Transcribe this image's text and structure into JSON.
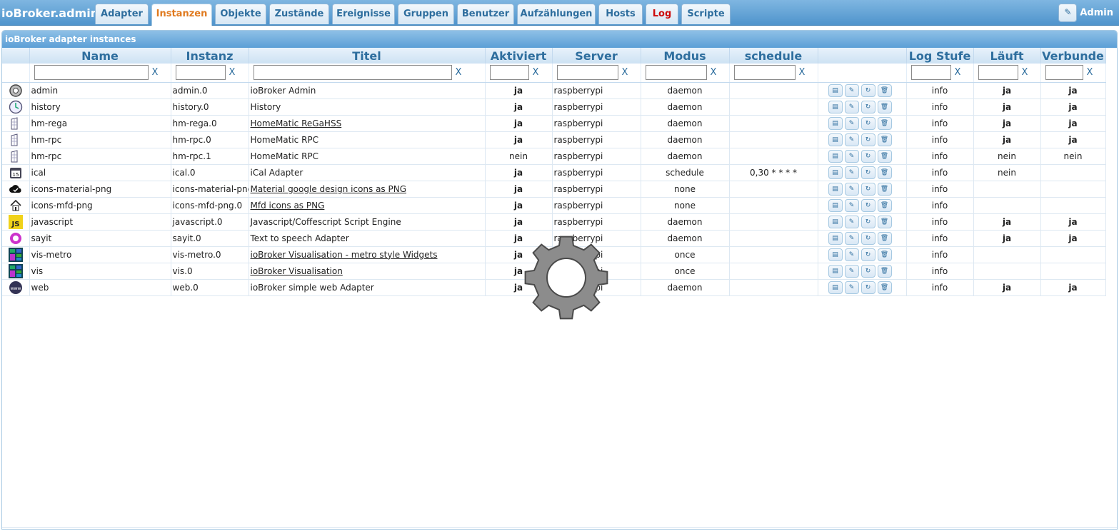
{
  "app": {
    "title": "ioBroker.admin"
  },
  "tabs": [
    {
      "label": "Adapter"
    },
    {
      "label": "Instanzen"
    },
    {
      "label": "Objekte"
    },
    {
      "label": "Zustände"
    },
    {
      "label": "Ereignisse"
    },
    {
      "label": "Gruppen"
    },
    {
      "label": "Benutzer"
    },
    {
      "label": "Aufzählungen"
    },
    {
      "label": "Hosts"
    },
    {
      "label": "Log"
    },
    {
      "label": "Scripte"
    }
  ],
  "user_menu": {
    "label": "Admin",
    "icon": "pencil-icon"
  },
  "panel": {
    "title": "ioBroker adapter instances"
  },
  "columns": {
    "name": "Name",
    "instanz": "Instanz",
    "titel": "Titel",
    "aktiviert": "Aktiviert",
    "server": "Server",
    "modus": "Modus",
    "schedule": "schedule",
    "actions": "",
    "log": "Log Stufe",
    "laeuft": "Läuft",
    "verbunden": "Verbunde"
  },
  "filter": {
    "clear_label": "X"
  },
  "rows": [
    {
      "icon": "gear-icon",
      "name": "admin",
      "instanz": "admin.0",
      "titel": "ioBroker Admin",
      "link": false,
      "aktiviert": "ja",
      "server": "raspberrypi",
      "modus": "daemon",
      "schedule": "",
      "log": "info",
      "laeuft": "ja",
      "verbunden": "ja"
    },
    {
      "icon": "clock-icon",
      "name": "history",
      "instanz": "history.0",
      "titel": "History",
      "link": false,
      "aktiviert": "ja",
      "server": "raspberrypi",
      "modus": "daemon",
      "schedule": "",
      "log": "info",
      "laeuft": "ja",
      "verbunden": "ja"
    },
    {
      "icon": "homematic-icon",
      "name": "hm-rega",
      "instanz": "hm-rega.0",
      "titel": "HomeMatic ReGaHSS",
      "link": true,
      "aktiviert": "ja",
      "server": "raspberrypi",
      "modus": "daemon",
      "schedule": "",
      "log": "info",
      "laeuft": "ja",
      "verbunden": "ja"
    },
    {
      "icon": "homematic-icon",
      "name": "hm-rpc",
      "instanz": "hm-rpc.0",
      "titel": "HomeMatic RPC",
      "link": false,
      "aktiviert": "ja",
      "server": "raspberrypi",
      "modus": "daemon",
      "schedule": "",
      "log": "info",
      "laeuft": "ja",
      "verbunden": "ja"
    },
    {
      "icon": "homematic-icon",
      "name": "hm-rpc",
      "instanz": "hm-rpc.1",
      "titel": "HomeMatic RPC",
      "link": false,
      "aktiviert": "nein",
      "server": "raspberrypi",
      "modus": "daemon",
      "schedule": "",
      "log": "info",
      "laeuft": "nein",
      "verbunden": "nein"
    },
    {
      "icon": "calendar-icon",
      "name": "ical",
      "instanz": "ical.0",
      "titel": "iCal Adapter",
      "link": false,
      "aktiviert": "ja",
      "server": "raspberrypi",
      "modus": "schedule",
      "schedule": "0,30 * * * *",
      "log": "info",
      "laeuft": "nein",
      "verbunden": ""
    },
    {
      "icon": "cloud-check-icon",
      "name": "icons-material-png",
      "instanz": "icons-material-png",
      "titel": "Material google design icons as PNG",
      "link": true,
      "aktiviert": "ja",
      "server": "raspberrypi",
      "modus": "none",
      "schedule": "",
      "log": "info",
      "laeuft": "",
      "verbunden": ""
    },
    {
      "icon": "home-icon",
      "name": "icons-mfd-png",
      "instanz": "icons-mfd-png.0",
      "titel": "Mfd icons as PNG",
      "link": true,
      "aktiviert": "ja",
      "server": "raspberrypi",
      "modus": "none",
      "schedule": "",
      "log": "info",
      "laeuft": "",
      "verbunden": ""
    },
    {
      "icon": "js-icon",
      "name": "javascript",
      "instanz": "javascript.0",
      "titel": "Javascript/Coffescript Script Engine",
      "link": false,
      "aktiviert": "ja",
      "server": "raspberrypi",
      "modus": "daemon",
      "schedule": "",
      "log": "info",
      "laeuft": "ja",
      "verbunden": "ja"
    },
    {
      "icon": "speech-icon",
      "name": "sayit",
      "instanz": "sayit.0",
      "titel": "Text to speech Adapter",
      "link": false,
      "aktiviert": "ja",
      "server": "raspberrypi",
      "modus": "daemon",
      "schedule": "",
      "log": "info",
      "laeuft": "ja",
      "verbunden": "ja"
    },
    {
      "icon": "tiles-icon",
      "name": "vis-metro",
      "instanz": "vis-metro.0",
      "titel": "ioBroker Visualisation - metro style Widgets",
      "link": true,
      "aktiviert": "ja",
      "server": "raspberrypi",
      "modus": "once",
      "schedule": "",
      "log": "info",
      "laeuft": "",
      "verbunden": ""
    },
    {
      "icon": "tiles-icon",
      "name": "vis",
      "instanz": "vis.0",
      "titel": "ioBroker Visualisation",
      "link": true,
      "aktiviert": "ja",
      "server": "raspberrypi",
      "modus": "once",
      "schedule": "",
      "log": "info",
      "laeuft": "",
      "verbunden": ""
    },
    {
      "icon": "globe-icon",
      "name": "web",
      "instanz": "web.0",
      "titel": "ioBroker simple web Adapter",
      "link": false,
      "aktiviert": "ja",
      "server": "raspberrypi",
      "modus": "daemon",
      "schedule": "",
      "log": "info",
      "laeuft": "ja",
      "verbunden": "ja"
    }
  ],
  "row_actions": [
    {
      "icon": "config-list-icon"
    },
    {
      "icon": "pencil-icon"
    },
    {
      "icon": "reload-icon"
    },
    {
      "icon": "trash-icon"
    }
  ],
  "colors": {
    "accent": "#2e6e9e",
    "active_tab": "#e07a1f",
    "ja": "#1a8a1a",
    "nein": "#cc0000",
    "header": "#5c9fd6"
  }
}
